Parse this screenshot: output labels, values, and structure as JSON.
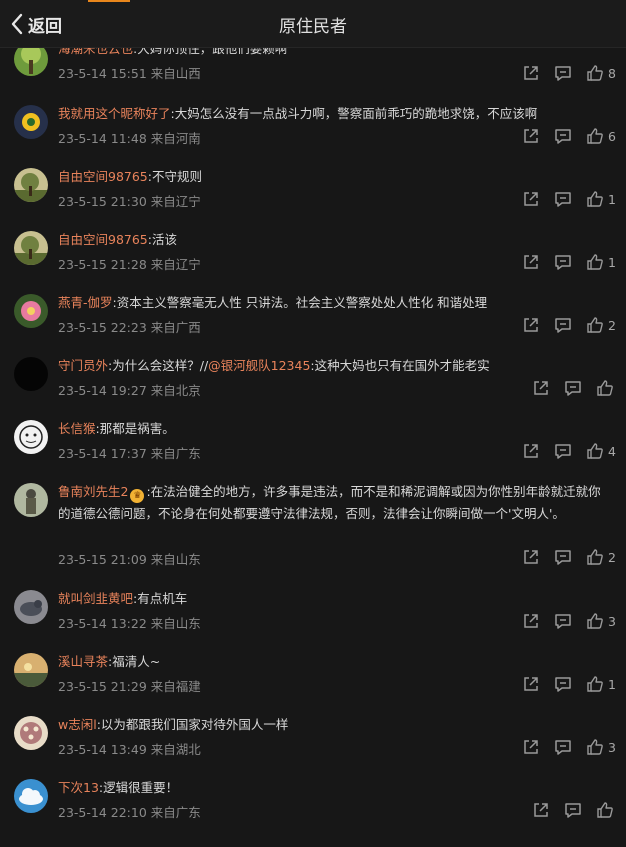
{
  "header": {
    "back_label": "返回",
    "title": "原住民者",
    "accent_color": "#e8861c"
  },
  "comments": [
    {
      "user": "海潮米也云也",
      "vip": false,
      "text_parts": [
        ":大妈你顶住，跟他们耍赖啊"
      ],
      "mention": "",
      "text_after": "",
      "time": "23-5-14 15:51",
      "location": "来自山西",
      "likes": "8",
      "avatar": "tree-avatar"
    },
    {
      "user": "我就用这个昵称好了",
      "vip": false,
      "text_parts": [
        ":大妈怎么没有一点战斗力啊，警察面前乖巧的跪地求饶，不应该啊"
      ],
      "mention": "",
      "text_after": "",
      "time": "23-5-14 11:48",
      "location": "来自河南",
      "likes": "6",
      "avatar": "flower-avatar"
    },
    {
      "user": "自由空间98765",
      "vip": false,
      "text_parts": [
        ":不守规则"
      ],
      "mention": "",
      "text_after": "",
      "time": "23-5-15 21:30",
      "location": "来自辽宁",
      "likes": "1",
      "avatar": "sunset-tree-avatar"
    },
    {
      "user": "自由空间98765",
      "vip": false,
      "text_parts": [
        ":活该"
      ],
      "mention": "",
      "text_after": "",
      "time": "23-5-15 21:28",
      "location": "来自辽宁",
      "likes": "1",
      "avatar": "sunset-tree-avatar"
    },
    {
      "user": "燕青-伽罗",
      "vip": false,
      "text_parts": [
        ":资本主义警察毫无人性 只讲法。社会主义警察处处人性化 和谐处理"
      ],
      "mention": "",
      "text_after": "",
      "time": "23-5-15 22:23",
      "location": "来自广西",
      "likes": "2",
      "avatar": "lotus-avatar"
    },
    {
      "user": "守门员外",
      "vip": false,
      "text_parts": [
        ":为什么会这样？//"
      ],
      "mention": "@银河舰队12345",
      "text_after": ":这种大妈也只有在国外才能老实",
      "time": "23-5-14 19:27",
      "location": "来自北京",
      "likes": "",
      "avatar": "black-avatar"
    },
    {
      "user": "长信猴",
      "vip": false,
      "text_parts": [
        ":那都是祸害。"
      ],
      "mention": "",
      "text_after": "",
      "time": "23-5-14 17:37",
      "location": "来自广东",
      "likes": "4",
      "avatar": "sketch-avatar"
    },
    {
      "user": "鲁南刘先生2",
      "vip": true,
      "text_parts": [
        ":在法治健全的地方，许多事是违法，而不是和稀泥调解或因为你性别年龄就迁就你的道德公德问题，不论身在何处都要遵守法律法规，否则，法律会让你瞬间做一个'文明人'。"
      ],
      "mention": "",
      "text_after": "",
      "time": "23-5-15 21:09",
      "location": "来自山东",
      "likes": "2",
      "avatar": "statue-avatar"
    },
    {
      "user": "就叫剑韭黄吧",
      "vip": false,
      "text_parts": [
        ":有点机车"
      ],
      "mention": "",
      "text_after": "",
      "time": "23-5-14 13:22",
      "location": "来自山东",
      "likes": "3",
      "avatar": "bird-avatar"
    },
    {
      "user": "溪山寻茶",
      "vip": false,
      "text_parts": [
        ":福清人~"
      ],
      "mention": "",
      "text_after": "",
      "time": "23-5-15 21:29",
      "location": "来自福建",
      "likes": "1",
      "avatar": "landscape-avatar"
    },
    {
      "user": "w志闲l",
      "vip": false,
      "text_parts": [
        ":以为都跟我们国家对待外国人一样"
      ],
      "mention": "",
      "text_after": "",
      "time": "23-5-14 13:49",
      "location": "来自湖北",
      "likes": "3",
      "avatar": "pattern-avatar"
    },
    {
      "user": "下次13",
      "vip": false,
      "text_parts": [
        ":逻辑很重要！"
      ],
      "mention": "",
      "text_after": "",
      "time": "23-5-14 22:10",
      "location": "来自广东",
      "likes": "",
      "avatar": "cloud-avatar"
    }
  ],
  "icons": {
    "share": "share-icon",
    "comment": "comment-icon",
    "like": "thumbs-up-icon"
  }
}
